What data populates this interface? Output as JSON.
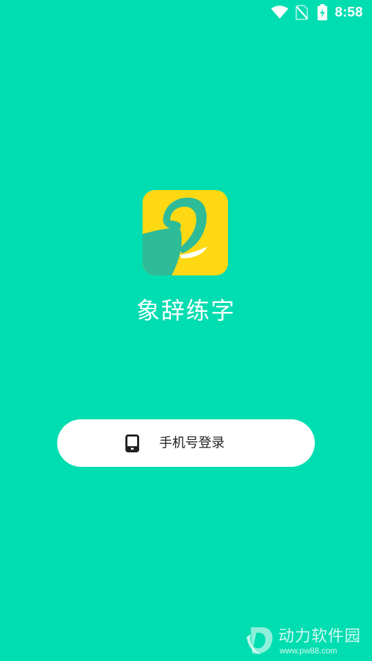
{
  "theme": {
    "background": "#00DDB0",
    "logo_yellow": "#FFD814",
    "logo_teal": "#2DBB98",
    "button_bg": "#FFFFFF",
    "text_on_bg": "#FFFFFF",
    "button_text": "#222222"
  },
  "status_bar": {
    "time": "8:58",
    "icons": [
      "wifi-icon",
      "no-sim-icon",
      "battery-charging-icon"
    ]
  },
  "app": {
    "name": "象辞练字",
    "logo_icon": "elephant-logo-icon"
  },
  "login": {
    "icon": "phone-icon",
    "label": "手机号登录"
  },
  "watermark": {
    "name": "动力软件园",
    "url": "www.pw88.com"
  }
}
